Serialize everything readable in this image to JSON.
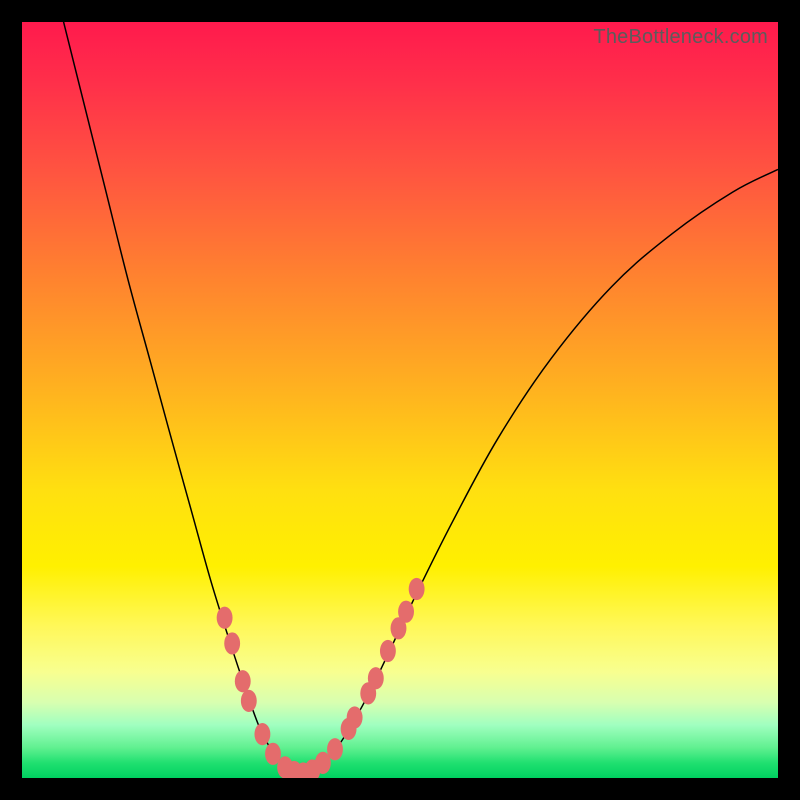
{
  "watermark": "TheBottleneck.com",
  "chart_data": {
    "type": "line",
    "title": "",
    "xlabel": "",
    "ylabel": "",
    "xlim": [
      0,
      1
    ],
    "ylim": [
      0,
      1
    ],
    "background_gradient": {
      "direction": "vertical",
      "stops": [
        {
          "pos": 0.0,
          "color": "#ff1a4d",
          "meaning": "worst"
        },
        {
          "pos": 0.5,
          "color": "#ffe010",
          "meaning": "mid"
        },
        {
          "pos": 1.0,
          "color": "#00d060",
          "meaning": "best"
        }
      ]
    },
    "series": [
      {
        "name": "left-curve",
        "description": "steep descending curve from top-left into valley",
        "points": [
          {
            "x": 0.055,
            "y": 1.0
          },
          {
            "x": 0.08,
            "y": 0.9
          },
          {
            "x": 0.11,
            "y": 0.78
          },
          {
            "x": 0.14,
            "y": 0.66
          },
          {
            "x": 0.17,
            "y": 0.55
          },
          {
            "x": 0.2,
            "y": 0.44
          },
          {
            "x": 0.225,
            "y": 0.35
          },
          {
            "x": 0.25,
            "y": 0.26
          },
          {
            "x": 0.275,
            "y": 0.18
          },
          {
            "x": 0.295,
            "y": 0.12
          },
          {
            "x": 0.315,
            "y": 0.065
          },
          {
            "x": 0.335,
            "y": 0.03
          },
          {
            "x": 0.355,
            "y": 0.012
          },
          {
            "x": 0.37,
            "y": 0.006
          }
        ]
      },
      {
        "name": "right-curve",
        "description": "ascending curve from valley toward upper-right",
        "points": [
          {
            "x": 0.37,
            "y": 0.006
          },
          {
            "x": 0.395,
            "y": 0.018
          },
          {
            "x": 0.42,
            "y": 0.045
          },
          {
            "x": 0.45,
            "y": 0.095
          },
          {
            "x": 0.48,
            "y": 0.155
          },
          {
            "x": 0.52,
            "y": 0.24
          },
          {
            "x": 0.57,
            "y": 0.34
          },
          {
            "x": 0.63,
            "y": 0.45
          },
          {
            "x": 0.7,
            "y": 0.555
          },
          {
            "x": 0.78,
            "y": 0.65
          },
          {
            "x": 0.86,
            "y": 0.72
          },
          {
            "x": 0.94,
            "y": 0.775
          },
          {
            "x": 1.0,
            "y": 0.805
          }
        ]
      }
    ],
    "markers": {
      "name": "highlighted-points",
      "color": "#e46c6c",
      "radius_frac": 0.014,
      "description": "salmon oval markers clustered around the valley minimum on both branches",
      "points": [
        {
          "x": 0.268,
          "y": 0.212
        },
        {
          "x": 0.278,
          "y": 0.178
        },
        {
          "x": 0.292,
          "y": 0.128
        },
        {
          "x": 0.3,
          "y": 0.102
        },
        {
          "x": 0.318,
          "y": 0.058
        },
        {
          "x": 0.332,
          "y": 0.032
        },
        {
          "x": 0.348,
          "y": 0.014
        },
        {
          "x": 0.36,
          "y": 0.008
        },
        {
          "x": 0.372,
          "y": 0.006
        },
        {
          "x": 0.384,
          "y": 0.01
        },
        {
          "x": 0.398,
          "y": 0.02
        },
        {
          "x": 0.414,
          "y": 0.038
        },
        {
          "x": 0.432,
          "y": 0.065
        },
        {
          "x": 0.44,
          "y": 0.08
        },
        {
          "x": 0.458,
          "y": 0.112
        },
        {
          "x": 0.468,
          "y": 0.132
        },
        {
          "x": 0.484,
          "y": 0.168
        },
        {
          "x": 0.498,
          "y": 0.198
        },
        {
          "x": 0.508,
          "y": 0.22
        },
        {
          "x": 0.522,
          "y": 0.25
        }
      ]
    }
  }
}
